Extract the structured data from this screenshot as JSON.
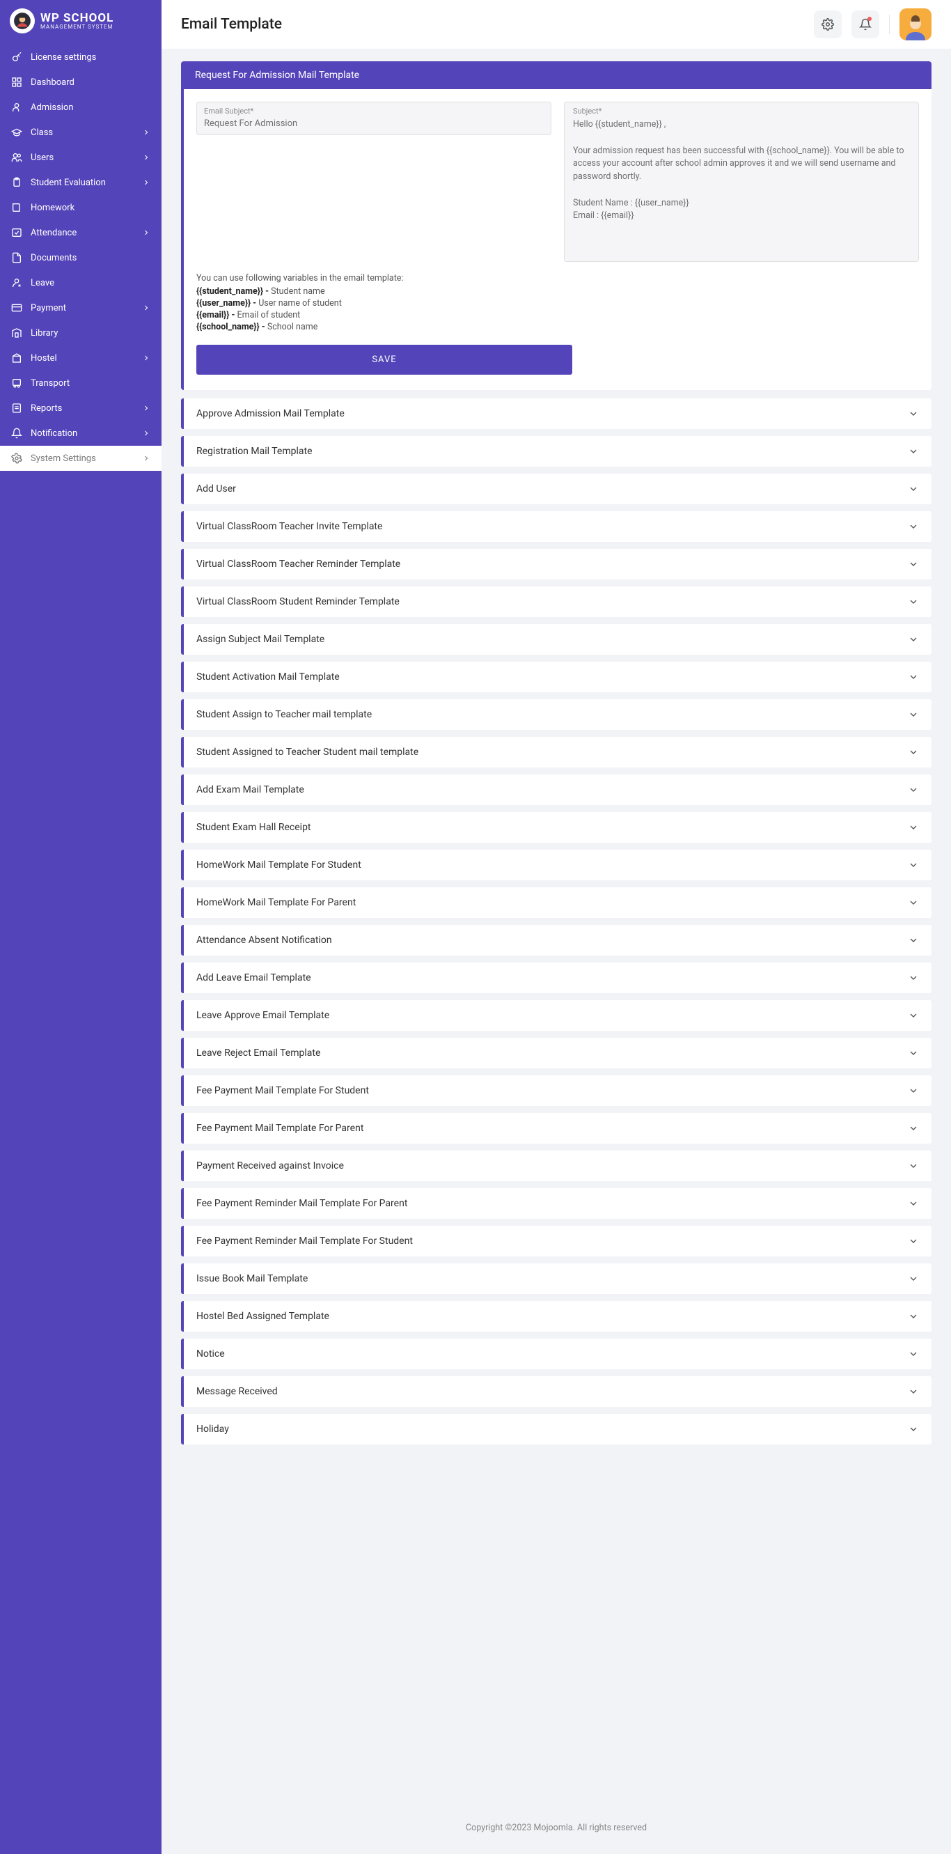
{
  "brand": {
    "line1": "WP SCHOOL",
    "line2": "MANAGEMENT SYSTEM"
  },
  "pageTitle": "Email Template",
  "sidebar": {
    "items": [
      {
        "label": "License settings",
        "icon": "key",
        "expandable": false
      },
      {
        "label": "Dashboard",
        "icon": "grid",
        "expandable": false
      },
      {
        "label": "Admission",
        "icon": "user",
        "expandable": false
      },
      {
        "label": "Class",
        "icon": "cap",
        "expandable": true
      },
      {
        "label": "Users",
        "icon": "users",
        "expandable": true
      },
      {
        "label": "Student Evaluation",
        "icon": "clipboard",
        "expandable": true
      },
      {
        "label": "Homework",
        "icon": "book",
        "expandable": false
      },
      {
        "label": "Attendance",
        "icon": "check",
        "expandable": true
      },
      {
        "label": "Documents",
        "icon": "doc",
        "expandable": false
      },
      {
        "label": "Leave",
        "icon": "leave",
        "expandable": false
      },
      {
        "label": "Payment",
        "icon": "card",
        "expandable": true
      },
      {
        "label": "Library",
        "icon": "library",
        "expandable": false
      },
      {
        "label": "Hostel",
        "icon": "hostel",
        "expandable": true
      },
      {
        "label": "Transport",
        "icon": "bus",
        "expandable": false
      },
      {
        "label": "Reports",
        "icon": "report",
        "expandable": true
      },
      {
        "label": "Notification",
        "icon": "bell",
        "expandable": true
      },
      {
        "label": "System Settings",
        "icon": "gear",
        "expandable": true,
        "active": true
      }
    ]
  },
  "panel": {
    "header": "Request For Admission Mail Template",
    "subjectLabel": "Email Subject*",
    "subjectValue": "Request For Admission",
    "bodyLabel": "Subject*",
    "bodyText": "Hello {{student_name}} ,\n\nYour admission request has been successful with {{school_name}}. You will be able to access your account after school admin approves it and we will send username and password shortly.\n\nStudent Name : {{user_name}}\nEmail : {{email}}",
    "varsIntro": "You can use following variables in the email template:",
    "vars": [
      {
        "k": "{{student_name}} - ",
        "v": "Student name"
      },
      {
        "k": "{{user_name}} - ",
        "v": "User name of student"
      },
      {
        "k": "{{email}} - ",
        "v": "Email of student"
      },
      {
        "k": "{{school_name}} - ",
        "v": "School name"
      }
    ],
    "saveLabel": "SAVE"
  },
  "accordions": [
    "Approve Admission Mail Template",
    "Registration Mail Template",
    "Add User",
    "Virtual ClassRoom Teacher Invite Template",
    "Virtual ClassRoom Teacher Reminder Template",
    "Virtual ClassRoom Student Reminder Template",
    "Assign Subject Mail Template",
    "Student Activation Mail Template",
    "Student Assign to Teacher mail template",
    "Student Assigned to Teacher Student mail template",
    "Add Exam Mail Template",
    "Student Exam Hall Receipt",
    "HomeWork Mail Template For Student",
    "HomeWork Mail Template For Parent",
    "Attendance Absent Notification",
    "Add Leave Email Template",
    "Leave Approve Email Template",
    "Leave Reject Email Template",
    "Fee Payment Mail Template For Student",
    "Fee Payment Mail Template For Parent",
    "Payment Received against Invoice",
    "Fee Payment Reminder Mail Template For Parent",
    "Fee Payment Reminder Mail Template For Student",
    "Issue Book Mail Template",
    "Hostel Bed Assigned Template",
    "Notice",
    "Message Received",
    "Holiday"
  ],
  "footer": "Copyright ©2023 Mojoomla. All rights reserved"
}
